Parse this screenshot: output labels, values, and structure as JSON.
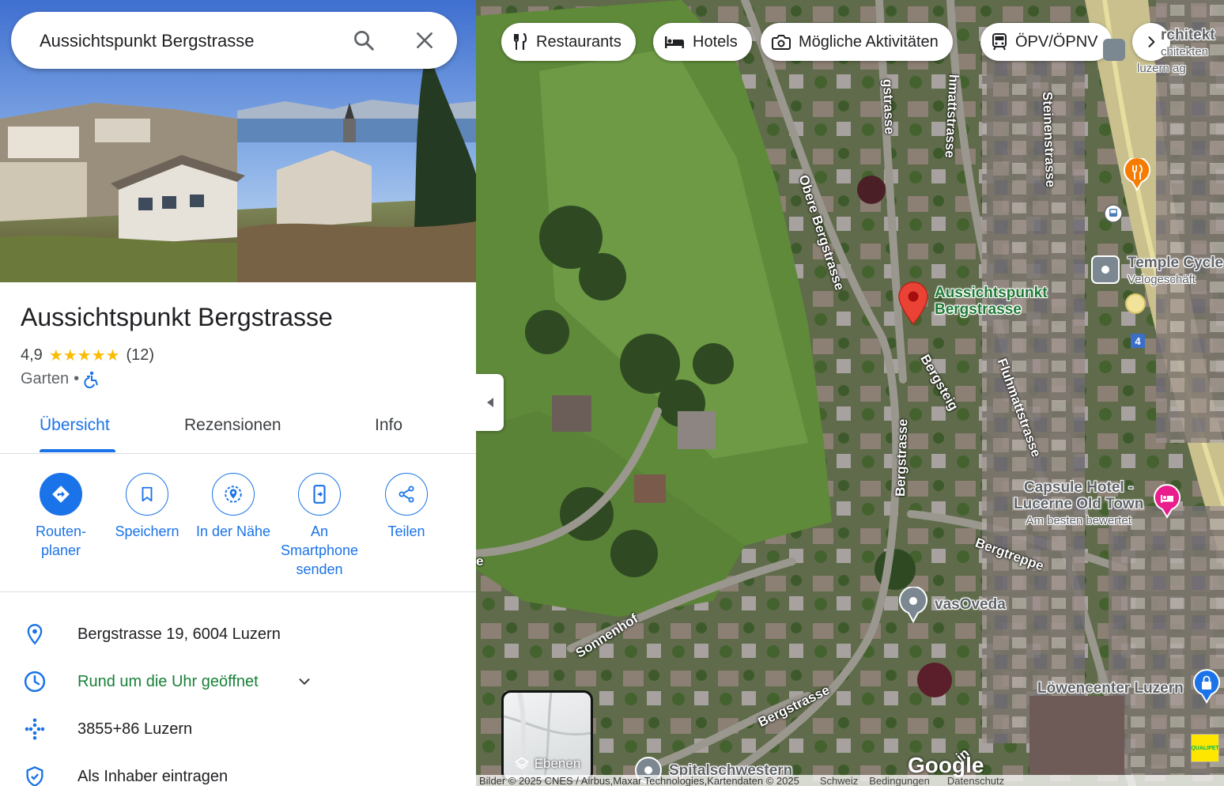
{
  "search": {
    "value": "Aussichtspunkt Bergstrasse"
  },
  "place": {
    "title": "Aussichtspunkt Bergstrasse",
    "rating": "4,9",
    "stars": "★★★★★",
    "rating_fraction": 0.98,
    "review_count": "(12)",
    "category": "Garten",
    "separator": "•"
  },
  "tabs": [
    {
      "label": "Übersicht",
      "active": true
    },
    {
      "label": "Rezensionen",
      "active": false
    },
    {
      "label": "Info",
      "active": false
    }
  ],
  "actions": [
    {
      "label": "Routen-\nplaner",
      "icon": "directions-icon"
    },
    {
      "label": "Speichern",
      "icon": "bookmark-icon"
    },
    {
      "label": "In der Nähe",
      "icon": "nearby-icon"
    },
    {
      "label": "An\nSmartphone\nsenden",
      "icon": "send-to-phone-icon"
    },
    {
      "label": "Teilen",
      "icon": "share-icon"
    }
  ],
  "info": {
    "address": "Bergstrasse 19, 6004 Luzern",
    "hours": "Rund um die Uhr geöffnet",
    "plus_code": "3855+86 Luzern",
    "claim": "Als Inhaber eintragen"
  },
  "map": {
    "chips": [
      {
        "label": "Restaurants",
        "icon": "restaurant-icon"
      },
      {
        "label": "Hotels",
        "icon": "hotel-icon"
      },
      {
        "label": "Mögliche Aktivitäten",
        "icon": "camera-icon"
      },
      {
        "label": "ÖPV/ÖPNV",
        "icon": "transit-icon"
      }
    ],
    "labels": {
      "selected_place_line1": "Aussichtspunkt",
      "selected_place_line2": "Bergstrasse",
      "temple_cycle": "Temple Cycle",
      "temple_cycle_sub": "Velogeschäft",
      "capsule_line1": "Capsule Hotel -",
      "capsule_line2": "Lucerne Old Town",
      "capsule_sub": "Am besten bewertet",
      "vasoveda": "vasOveda",
      "loewencenter": "Löwencenter Luzern",
      "spitalschwestern": "Spitalschwestern",
      "architekt": "rchitekt",
      "architekten_sub1": "chitekten",
      "architekten_sub2": "luzern ag",
      "route_number": "4"
    },
    "streets": {
      "obere_bergstrasse": "Obere Bergstrasse",
      "bergstrasse_top": "gstrasse",
      "bergstrasse_mid": "Bergstrasse",
      "bergstrasse_bottom": "Bergstrasse",
      "fluhmattstrasse_top": "hmattstrasse",
      "fluhmattstrasse": "Fluhmattstrasse",
      "steinenstrasse": "Steinenstrasse",
      "bergsteig": "Bergsteig",
      "bergtreppe": "Bergtreppe",
      "sonnenhof": "Sonnenhof",
      "left_edge_e": "e",
      "bottom_in": "in"
    },
    "layers_label": "Ebenen",
    "google_logo": "Google",
    "attribution": "Bilder © 2025 CNES / Airbus,Maxar Technologies,Kartendaten © 2025",
    "attr_links": [
      "Schweiz",
      "Bedingungen",
      "Datenschutz"
    ],
    "qualipet": "QUALIPET"
  },
  "colors": {
    "accent": "#1a73e8",
    "open_green": "#188038",
    "star": "#fbbc04",
    "pin_red": "#ea4335",
    "map_label_green": "#1e7a35",
    "hotel_pink": "#e91e8c",
    "food_orange": "#f57c00"
  }
}
